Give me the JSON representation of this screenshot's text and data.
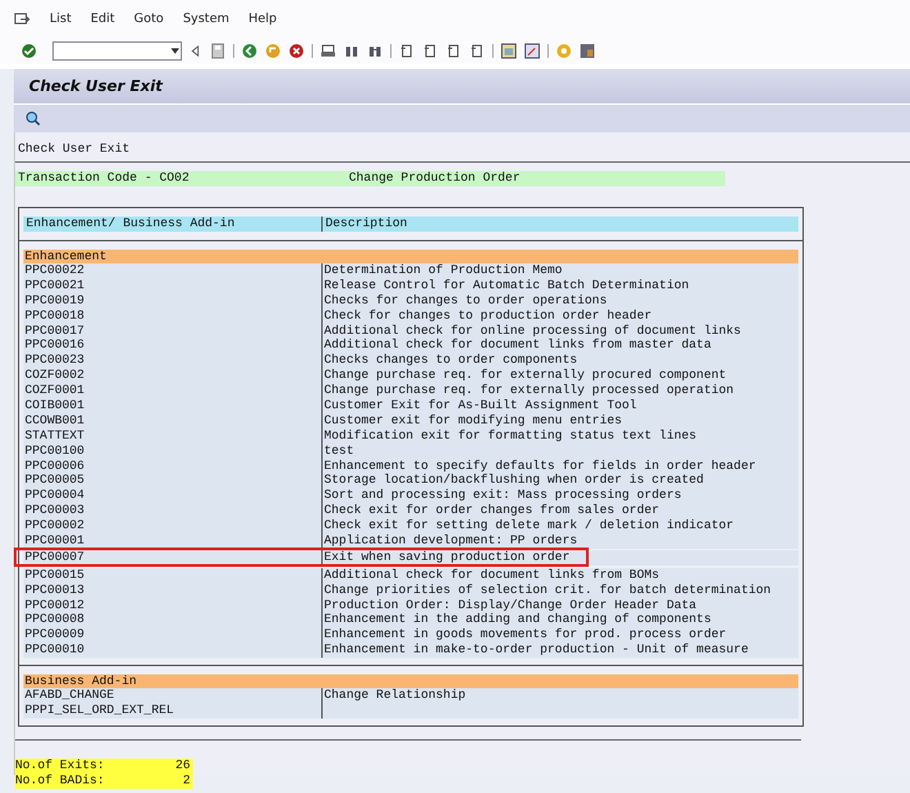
{
  "menu": [
    {
      "label": "List"
    },
    {
      "label": "Edit"
    },
    {
      "label": "Goto"
    },
    {
      "label": "System"
    },
    {
      "label": "Help"
    }
  ],
  "window": {
    "title": "Check User Exit"
  },
  "list_heading": "Check User Exit",
  "transaction": {
    "label": "Transaction Code - CO02",
    "description": "Change Production Order"
  },
  "columns": [
    "Enhancement/ Business Add-in",
    "Description"
  ],
  "sections": [
    {
      "title": "Enhancement",
      "rows": [
        {
          "name": "PPC00022",
          "description": "Determination of Production Memo",
          "highlighted": false
        },
        {
          "name": "PPC00021",
          "description": "Release Control for Automatic Batch Determination",
          "highlighted": false
        },
        {
          "name": "PPC00019",
          "description": "Checks for changes to order operations",
          "highlighted": false
        },
        {
          "name": "PPC00018",
          "description": "Check for changes to production order header",
          "highlighted": false
        },
        {
          "name": "PPC00017",
          "description": "Additional check for online processing of document links",
          "highlighted": false
        },
        {
          "name": "PPC00016",
          "description": "Additional check for document links from master data",
          "highlighted": false
        },
        {
          "name": "PPC00023",
          "description": "Checks changes to order components",
          "highlighted": false
        },
        {
          "name": "COZF0002",
          "description": "Change purchase req. for externally procured component",
          "highlighted": false
        },
        {
          "name": "COZF0001",
          "description": "Change purchase req. for externally processed operation",
          "highlighted": false
        },
        {
          "name": "COIB0001",
          "description": "Customer Exit for As-Built Assignment Tool",
          "highlighted": false
        },
        {
          "name": "CCOWB001",
          "description": "Customer exit for modifying menu entries",
          "highlighted": false
        },
        {
          "name": "STATTEXT",
          "description": "Modification exit for formatting status text lines",
          "highlighted": false
        },
        {
          "name": "PPC00100",
          "description": "test",
          "highlighted": false
        },
        {
          "name": "PPC00006",
          "description": "Enhancement to specify defaults for fields in order header",
          "highlighted": false
        },
        {
          "name": "PPC00005",
          "description": "Storage location/backflushing when order is created",
          "highlighted": false
        },
        {
          "name": "PPC00004",
          "description": "Sort and processing exit: Mass processing orders",
          "highlighted": false
        },
        {
          "name": "PPC00003",
          "description": "Check exit for order changes from sales order",
          "highlighted": false
        },
        {
          "name": "PPC00002",
          "description": "Check exit for setting delete mark / deletion indicator",
          "highlighted": false
        },
        {
          "name": "PPC00001",
          "description": "Application development: PP orders",
          "highlighted": false
        },
        {
          "name": "PPC00007",
          "description": "Exit when saving production order",
          "highlighted": true
        },
        {
          "name": "PPC00015",
          "description": "Additional check for document links from BOMs",
          "highlighted": false
        },
        {
          "name": "PPC00013",
          "description": "Change priorities of selection crit. for batch determination",
          "highlighted": false
        },
        {
          "name": "PPC00012",
          "description": "Production Order: Display/Change Order Header Data",
          "highlighted": false
        },
        {
          "name": "PPC00008",
          "description": "Enhancement in the adding and changing of components",
          "highlighted": false
        },
        {
          "name": "PPC00009",
          "description": "Enhancement in goods movements for prod. process order",
          "highlighted": false
        },
        {
          "name": "PPC00010",
          "description": "Enhancement in make-to-order production - Unit of measure",
          "highlighted": false
        }
      ]
    },
    {
      "title": "Business Add-in",
      "rows": [
        {
          "name": "AFABD_CHANGE",
          "description": "Change Relationship",
          "highlighted": false
        },
        {
          "name": "PPPI_SEL_ORD_EXT_REL",
          "highlighted": false
        }
      ]
    }
  ],
  "totals": [
    {
      "label": "No.of Exits:",
      "value": "26"
    },
    {
      "label": "No.of BADis:",
      "value": "2"
    }
  ]
}
